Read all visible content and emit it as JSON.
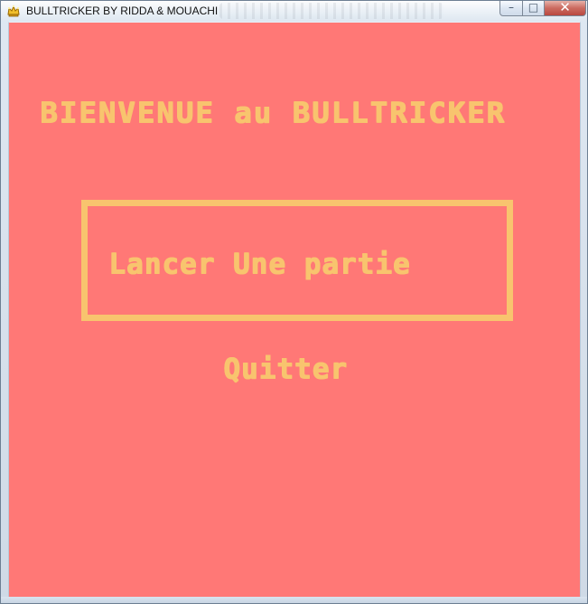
{
  "window": {
    "title": "BULLTRICKER BY RIDDA & MOUACHI",
    "icon": "crown-icon",
    "controls": {
      "minimize": "–",
      "maximize": "□",
      "close": "✕"
    }
  },
  "menu": {
    "welcome_text": "BIENVENUE au BULLTRICKER",
    "start_label": "Lancer Une partie",
    "quit_label": "Quitter"
  },
  "colors": {
    "background": "#ff7876",
    "menu_text": "#f8c46e"
  }
}
